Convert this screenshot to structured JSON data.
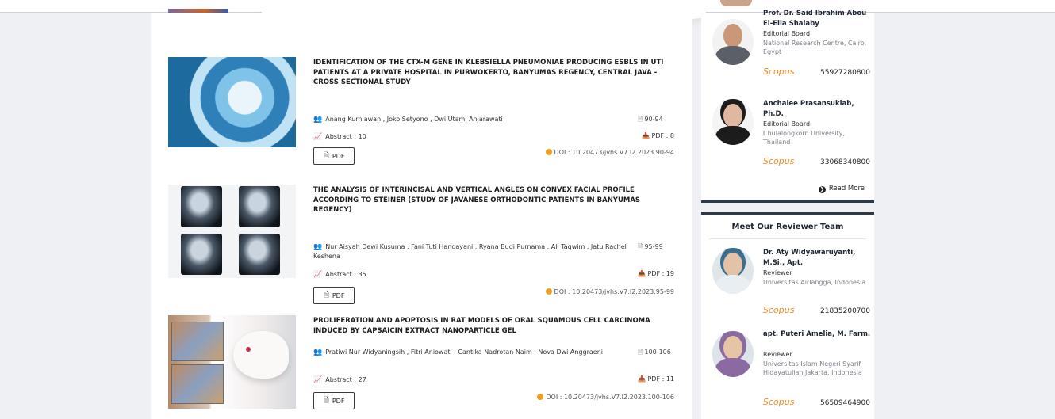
{
  "articles": [
    {
      "title": "IDENTIFICATION OF THE CTX-M GENE IN KLEBSIELLA PNEUMONIAE PRODUCING ESBLS IN UTI PATIENTS AT A PRIVATE HOSPITAL IN PURWOKERTO, BANYUMAS REGENCY, CENTRAL JAVA - CROSS SECTIONAL STUDY",
      "authors": "Anang Kurniawan , Joko Setyono , Dwi Utami Anjarawati",
      "pages": "90-94",
      "abstract": "Abstract : 10",
      "pdf_count": "PDF : 8",
      "doi": "DOI : 10.20473/jvhs.V7.I2.2023.90-94",
      "pdf_label": "PDF"
    },
    {
      "title": "THE ANALYSIS OF INTERINCISAL AND VERTICAL ANGLES ON CONVEX FACIAL PROFILE ACCORDING TO STEINER (STUDY OF JAVANESE ORTHODONTIC PATIENTS IN BANYUMAS REGENCY)",
      "authors": "Nur Aisyah Dewi Kusuma , Fani Tuti Handayani , Ryana Budi Purnama , Ali Taqwim , Jatu Rachel Keshena",
      "pages": "95-99",
      "abstract": "Abstract : 35",
      "pdf_count": "PDF : 19",
      "doi": "DOI : 10.20473/jvhs.V7.I2.2023.95-99",
      "pdf_label": "PDF"
    },
    {
      "title": "PROLIFERATION AND APOPTOSIS IN RAT MODELS OF ORAL SQUAMOUS CELL CARCINOMA INDUCED BY CAPSAICIN EXTRACT NANOPARTICLE GEL",
      "authors": "Pratiwi Nur Widyaningsih , Fitri Aniowati , Cantika Nadrotan Naim , Nova Dwi Anggraeni",
      "pages": "100-106",
      "abstract": "Abstract : 27",
      "pdf_count": "PDF : 11",
      "doi": "DOI : 10.20473/jvhs.V7.I2.2023.100-106",
      "pdf_label": "PDF"
    }
  ],
  "editorial": {
    "members": [
      {
        "name": "Prof. Dr. Said Ibrahim Abou El-Ella Shalaby",
        "role": "Editorial Board",
        "affiliation": "National Research Centre, Cairo, Egypt",
        "scopus_label": "Scopus",
        "scopus_id": "55927280800"
      },
      {
        "name": "Anchalee Prasansuklab, Ph.D.",
        "role": "Editorial Board",
        "affiliation": "Chulalongkorn University, Thailand",
        "scopus_label": "Scopus",
        "scopus_id": "33068340800"
      }
    ],
    "read_more": "Read More"
  },
  "reviewers": {
    "title": "Meet Our Reviewer Team",
    "members": [
      {
        "name": "Dr. Aty Widyawaruyanti, M.Si., Apt.",
        "role": "Reviewer",
        "affiliation": "Universitas Airlangga, Indonesia",
        "scopus_label": "Scopus",
        "scopus_id": "21835200700"
      },
      {
        "name": "apt. Puteri Amelia, M. Farm.",
        "role": "Reviewer",
        "affiliation": "Universitas Islam Negeri Syarif Hidayatullah Jakarta, Indonesia",
        "scopus_label": "Scopus",
        "scopus_id": "56509464900"
      }
    ]
  },
  "icons": {
    "authors": "users-icon",
    "abstract": "chart-line-icon",
    "pages": "file-icon",
    "pdf_count": "download-icon",
    "doi": "doi-icon",
    "read_more": "chevron-circle-right-icon"
  },
  "colors": {
    "scopus": "#f08a1c",
    "doi_badge": "#f0a020",
    "accent_dark": "#2b3a4a"
  }
}
